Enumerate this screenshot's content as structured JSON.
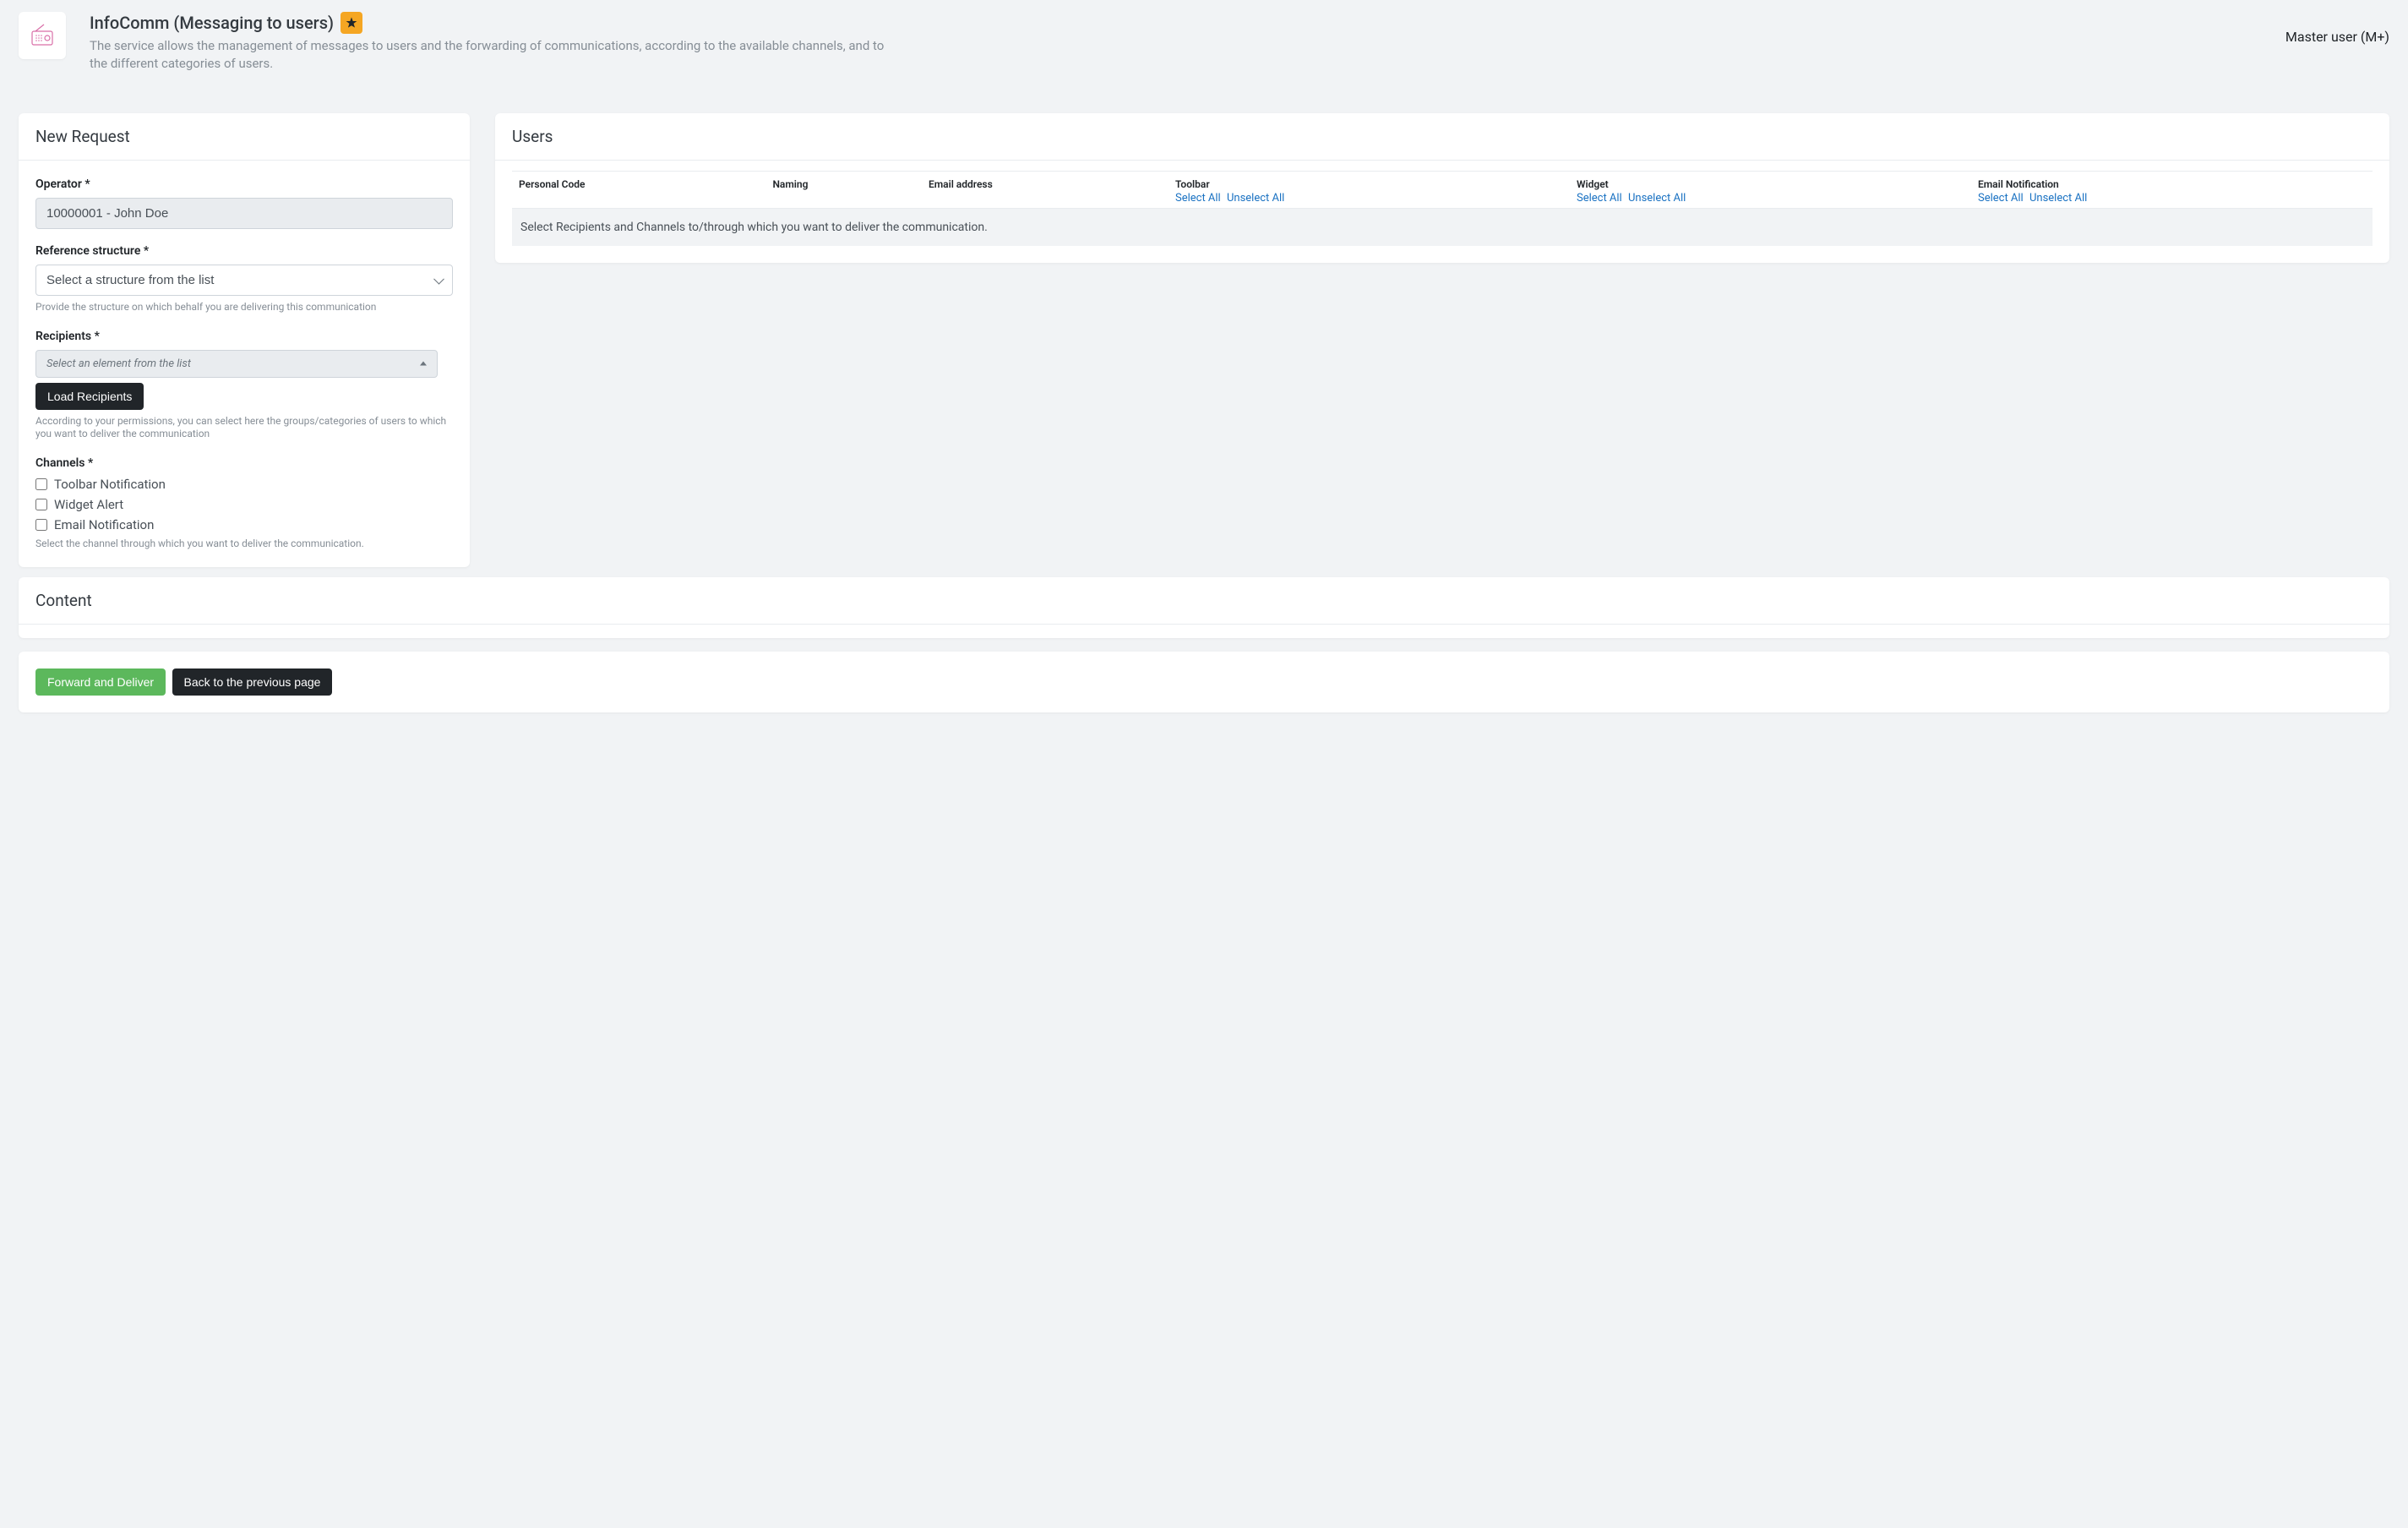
{
  "header": {
    "title": "InfoComm (Messaging to users)",
    "description": "The service allows the management of messages to users and the forwarding of communications, according to the available channels, and to the different categories of users.",
    "user_label": "Master user (M+)"
  },
  "new_request": {
    "title": "New Request",
    "operator_label": "Operator *",
    "operator_value": "10000001 - John Doe",
    "structure_label": "Reference structure *",
    "structure_placeholder": "Select a structure from the list",
    "structure_help": "Provide the structure on which behalf you are delivering this communication",
    "recipients_label": "Recipients *",
    "recipients_placeholder": "Select an element from the list",
    "load_recipients_label": "Load Recipients",
    "recipients_help": "According to your permissions, you can select here the groups/categories of users to which you want to deliver the communication",
    "channels_label": "Channels *",
    "channels": [
      "Toolbar Notification",
      "Widget Alert",
      "Email Notification"
    ],
    "channels_help": "Select the channel through which you want to deliver the communication."
  },
  "users": {
    "title": "Users",
    "columns": {
      "personal_code": "Personal Code",
      "naming": "Naming",
      "email": "Email address",
      "toolbar": "Toolbar",
      "widget": "Widget",
      "email_notif": "Email Notification"
    },
    "select_all": "Select All",
    "unselect_all": "Unselect All",
    "empty_text": "Select Recipients and Channels to/through which you want to deliver the communication."
  },
  "content_card": {
    "title": "Content"
  },
  "actions": {
    "forward": "Forward and Deliver",
    "back": "Back to the previous page"
  }
}
